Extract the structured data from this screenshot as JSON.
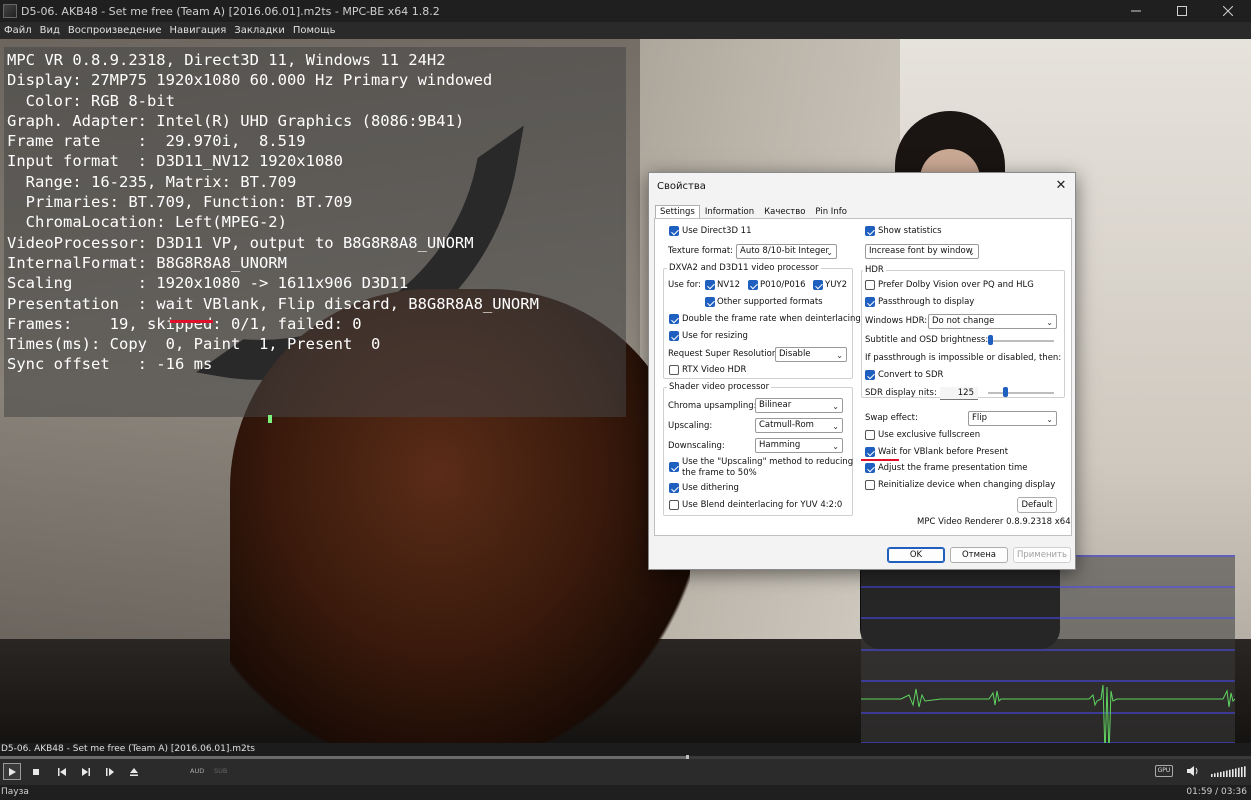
{
  "window": {
    "title": "D5-06. AKB48 - Set me free (Team A) [2016.06.01].m2ts - MPC-BE x64 1.8.2"
  },
  "menu": [
    "Файл",
    "Вид",
    "Воспроизведение",
    "Навигация",
    "Закладки",
    "Помощь"
  ],
  "stats": {
    "lines": [
      "MPC VR 0.8.9.2318, Direct3D 11, Windows 11 24H2",
      "Display: 27MP75 1920x1080 60.000 Hz Primary windowed",
      "  Color: RGB 8-bit",
      "Graph. Adapter: Intel(R) UHD Graphics (8086:9B41)",
      "Frame rate    :  29.970i,  8.519",
      "Input format  : D3D11_NV12 1920x1080",
      "  Range: 16-235, Matrix: BT.709",
      "  Primaries: BT.709, Function: BT.709",
      "  ChromaLocation: Left(MPEG-2)",
      "VideoProcessor: D3D11 VP, output to B8G8R8A8_UNORM",
      "InternalFormat: B8G8R8A8_UNORM",
      "Scaling       : 1920x1080 -> 1611x906 D3D11",
      "Presentation  : wait VBlank, Flip discard, B8G8R8A8_UNORM",
      "Frames:    19, skipped: 0/1, failed: 0",
      "Times(ms): Copy  0, Paint  1, Present  0",
      "Sync offset   : -16 ms"
    ]
  },
  "dialog": {
    "title": "Свойства",
    "tabs": [
      "Settings",
      "Information",
      "Качество",
      "Pin Info"
    ],
    "left": {
      "use_d3d11": "Use Direct3D 11",
      "texture_format_label": "Texture format:",
      "texture_format_value": "Auto 8/10-bit Integer",
      "dxva_group": "DXVA2 and D3D11 video processor",
      "use_for_label": "Use for:",
      "nv12": "NV12",
      "p010": "P010/P016",
      "yuy2": "YUY2",
      "other_formats": "Other supported formats",
      "double_frame": "Double the frame rate when deinterlacing",
      "use_resizing": "Use for resizing",
      "super_res_label": "Request Super Resolution:",
      "super_res_value": "Disable",
      "rtx_hdr": "RTX Video HDR",
      "shader_group": "Shader video processor",
      "chroma_label": "Chroma upsampling:",
      "chroma_value": "Bilinear",
      "upscaling_label": "Upscaling:",
      "upscaling_value": "Catmull-Rom",
      "downscaling_label": "Downscaling:",
      "downscaling_value": "Hamming",
      "use_upscaling_method": "Use the \"Upscaling\" method to reducing",
      "use_upscaling_method2": "the frame to 50%",
      "use_dithering": "Use dithering",
      "blend_deint": "Use Blend deinterlacing for YUV 4:2:0"
    },
    "right": {
      "show_statistics": "Show statistics",
      "font_value": "Increase font by window",
      "hdr_group": "HDR",
      "prefer_dolby": "Prefer Dolby Vision over PQ and HLG",
      "passthrough": "Passthrough to display",
      "windows_hdr_label": "Windows HDR:",
      "windows_hdr_value": "Do not change",
      "subtitle_brightness": "Subtitle and OSD brightness:",
      "if_passthrough": "If passthrough is impossible or disabled, then:",
      "convert_sdr": "Convert to SDR",
      "sdr_nits_label": "SDR display nits:",
      "sdr_nits_value": "125",
      "swap_label": "Swap effect:",
      "swap_value": "Flip",
      "exclusive_fullscreen": "Use exclusive fullscreen",
      "wait_vblank": "Wait for VBlank before Present",
      "adjust_presentation": "Adjust the frame presentation time",
      "reinit_device": "Reinitialize device when changing display",
      "default_btn": "Default",
      "renderer_version": "MPC Video Renderer 0.8.9.2318 x64"
    },
    "buttons": {
      "ok": "OK",
      "cancel": "Отмена",
      "apply": "Применить"
    }
  },
  "player": {
    "seek_title": "D5-06. AKB48 - Set me free (Team A) [2016.06.01].m2ts",
    "seek_progress": 0.549,
    "aud_label": "AUD",
    "sub_label": "SUB",
    "gpu_label": "GPU",
    "status": "Пауза",
    "time": "01:59 / 03:36"
  },
  "colors": {
    "accent": "#1f5fbf",
    "highlight": "#e0102a",
    "graph_line": "#5fd35f",
    "graph_grid": "#4a4aff"
  }
}
